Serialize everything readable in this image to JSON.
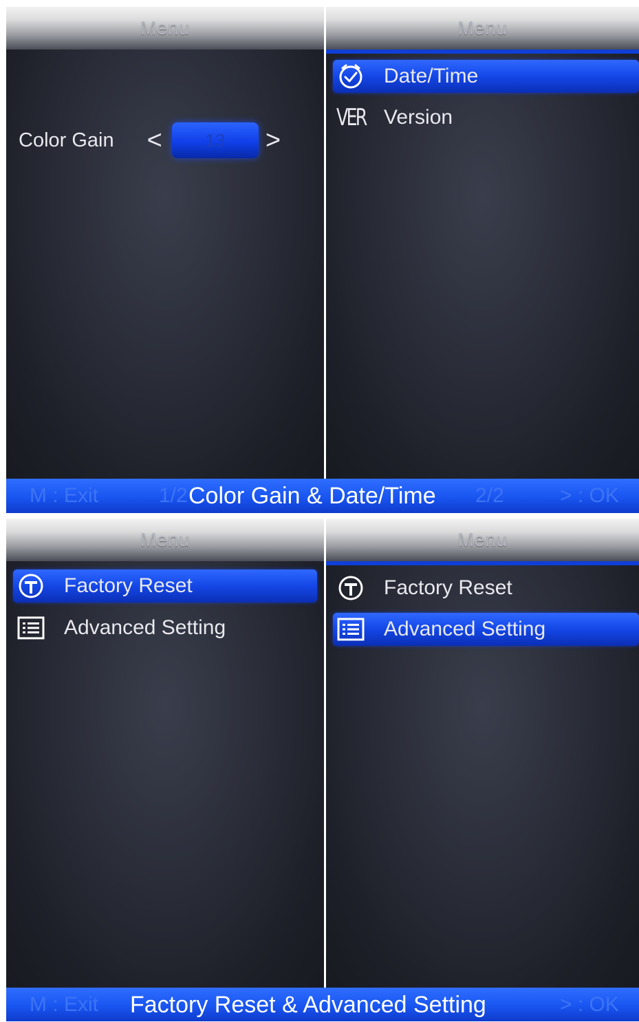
{
  "top": {
    "left_panel": {
      "header": "Menu",
      "color_gain": {
        "label": "Color Gain",
        "less": "<",
        "value": "13",
        "more": ">"
      }
    },
    "right_panel": {
      "header": "Menu",
      "items": [
        {
          "label": "Date/Time",
          "icon": "clock-icon",
          "selected": true
        },
        {
          "label": "Version",
          "icon": "ver-icon",
          "icon_text": "VER",
          "selected": false
        }
      ]
    },
    "footer": {
      "exit_hint": "M : Exit",
      "page_left": "1/2",
      "caption": "Color Gain & Date/Time",
      "page_right": "2/2",
      "ok_hint": "> : OK"
    }
  },
  "bottom": {
    "left_panel": {
      "header": "Menu",
      "items": [
        {
          "label": "Factory Reset",
          "icon": "hammer-icon",
          "selected": true
        },
        {
          "label": "Advanced Setting",
          "icon": "list-icon",
          "selected": false
        }
      ]
    },
    "right_panel": {
      "header": "Menu",
      "items": [
        {
          "label": "Factory Reset",
          "icon": "hammer-icon",
          "selected": false
        },
        {
          "label": "Advanced Setting",
          "icon": "list-icon",
          "selected": true
        }
      ]
    },
    "footer": {
      "exit_hint": "M : Exit",
      "caption": "Factory Reset & Advanced Setting",
      "ok_hint": "> : OK"
    }
  },
  "colors": {
    "highlight_blue": "#1447e6",
    "footer_blue": "#1955f0",
    "panel_dark": "#2a2d38"
  }
}
